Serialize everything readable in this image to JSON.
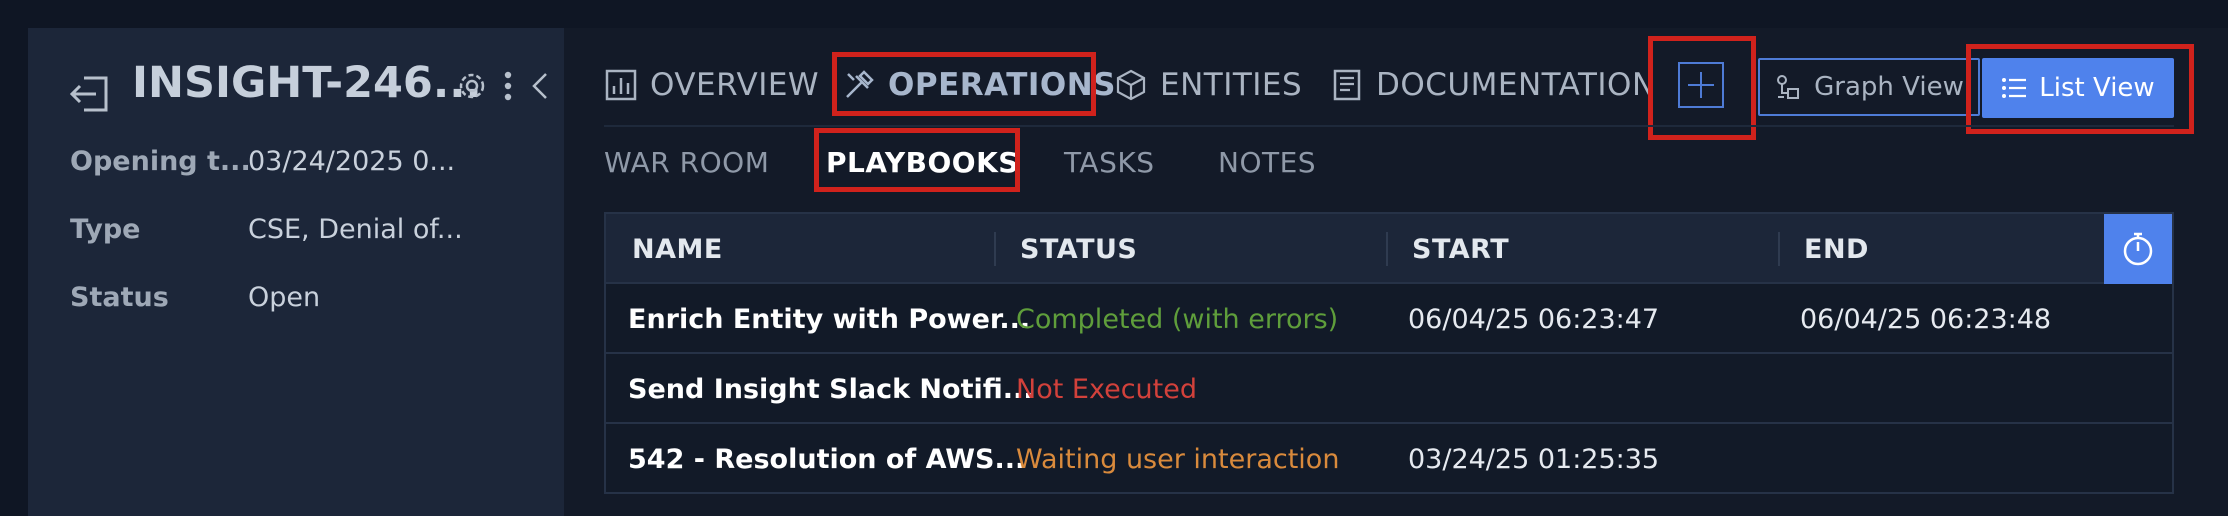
{
  "incident": {
    "title": "INSIGHT-246...",
    "fields": [
      {
        "label": "Opening t...",
        "value": "03/24/2025 0..."
      },
      {
        "label": "Type",
        "value": "CSE, Denial of..."
      },
      {
        "label": "Status",
        "value": "Open"
      }
    ]
  },
  "tabs": [
    {
      "label": "OVERVIEW",
      "icon": "chart-icon"
    },
    {
      "label": "OPERATIONS",
      "icon": "tools-icon"
    },
    {
      "label": "ENTITIES",
      "icon": "cube-icon"
    },
    {
      "label": "DOCUMENTATION",
      "icon": "document-icon"
    }
  ],
  "view_buttons": {
    "graph": "Graph View",
    "list": "List View"
  },
  "subtabs": [
    "WAR ROOM",
    "PLAYBOOKS",
    "TASKS",
    "NOTES"
  ],
  "table": {
    "columns": [
      "NAME",
      "STATUS",
      "START",
      "END"
    ],
    "rows": [
      {
        "name": "Enrich Entity with Power...",
        "status": "Completed (with errors)",
        "status_color": "#5f9e3b",
        "start": "06/04/25 06:23:47",
        "end": "06/04/25 06:23:48"
      },
      {
        "name": "Send Insight Slack Notifi...",
        "status": "Not Executed",
        "status_color": "#d2413b",
        "start": "",
        "end": ""
      },
      {
        "name": "542 - Resolution of AWS...",
        "status": "Waiting user interaction",
        "status_color": "#d98a3c",
        "start": "03/24/25 01:25:35",
        "end": ""
      }
    ]
  },
  "colors": {
    "accent": "#4f82ec",
    "highlight": "#d0221c"
  }
}
